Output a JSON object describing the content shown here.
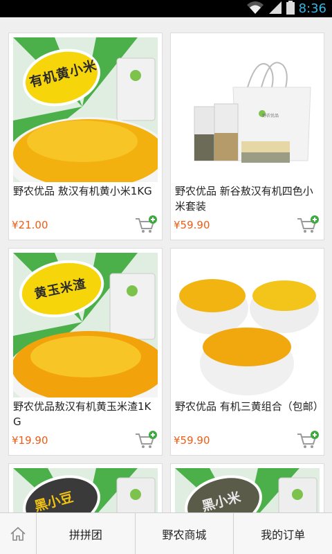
{
  "status_bar": {
    "time": "8:36",
    "icons": [
      "wifi-icon",
      "signal-icon",
      "battery-icon"
    ]
  },
  "products": [
    {
      "name": "野农优品 敖汉有机黄小米1KG",
      "price": "¥21.00",
      "image_label": "有机黄小米",
      "image": "millet-yellow"
    },
    {
      "name": "野农优品 新谷敖汉有机四色小米套装",
      "price": "¥59.90",
      "image_label": "野农优品",
      "image": "gift-set"
    },
    {
      "name": "野农优品敖汉有机黄玉米渣1KG",
      "price": "¥19.90",
      "image_label": "黄玉米渣",
      "image": "corn-grits"
    },
    {
      "name": "野农优品 有机三黄组合（包邮）",
      "price": "¥59.90",
      "image_label": "",
      "image": "three-bowls"
    },
    {
      "name": "",
      "price": "",
      "image_label": "黑小豆",
      "image": "black-bean"
    },
    {
      "name": "",
      "price": "",
      "image_label": "黑小米",
      "image": "black-millet"
    }
  ],
  "bottom_nav": {
    "home_icon": "home-icon",
    "items": [
      "拼拼团",
      "野农商城",
      "我的订单"
    ]
  },
  "colors": {
    "price": "#f25b13",
    "accent_green": "#3ea93e",
    "status_time": "#35b5e5"
  }
}
